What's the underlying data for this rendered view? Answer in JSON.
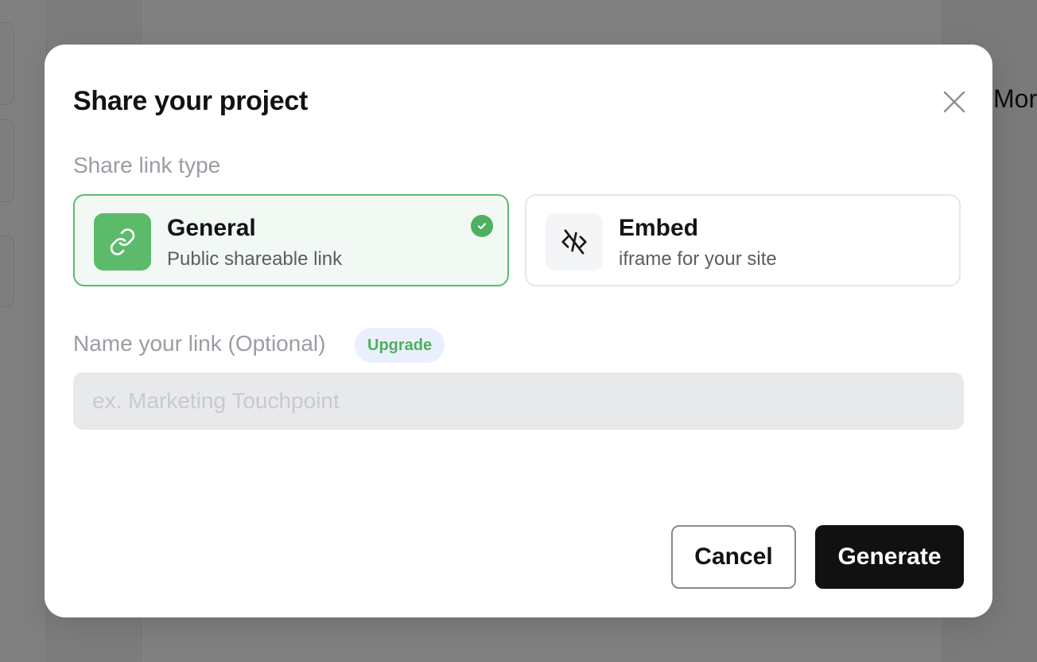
{
  "background": {
    "partial_text": "Mor"
  },
  "modal": {
    "title": "Share your project",
    "close_icon": "close-icon",
    "link_type_label": "Share link type",
    "options": [
      {
        "id": "general",
        "title": "General",
        "subtitle": "Public shareable link",
        "icon": "link-icon",
        "selected": true
      },
      {
        "id": "embed",
        "title": "Embed",
        "subtitle": "iframe for your site",
        "icon": "code-off-icon",
        "selected": false
      }
    ],
    "name_label": "Name your link (Optional)",
    "upgrade_badge": "Upgrade",
    "name_input": {
      "value": "",
      "placeholder": "ex. Marketing Touchpoint"
    },
    "cancel_label": "Cancel",
    "generate_label": "Generate"
  },
  "colors": {
    "accent_green": "#5cbb6b",
    "primary_button": "#111111",
    "overlay": "#808080"
  }
}
